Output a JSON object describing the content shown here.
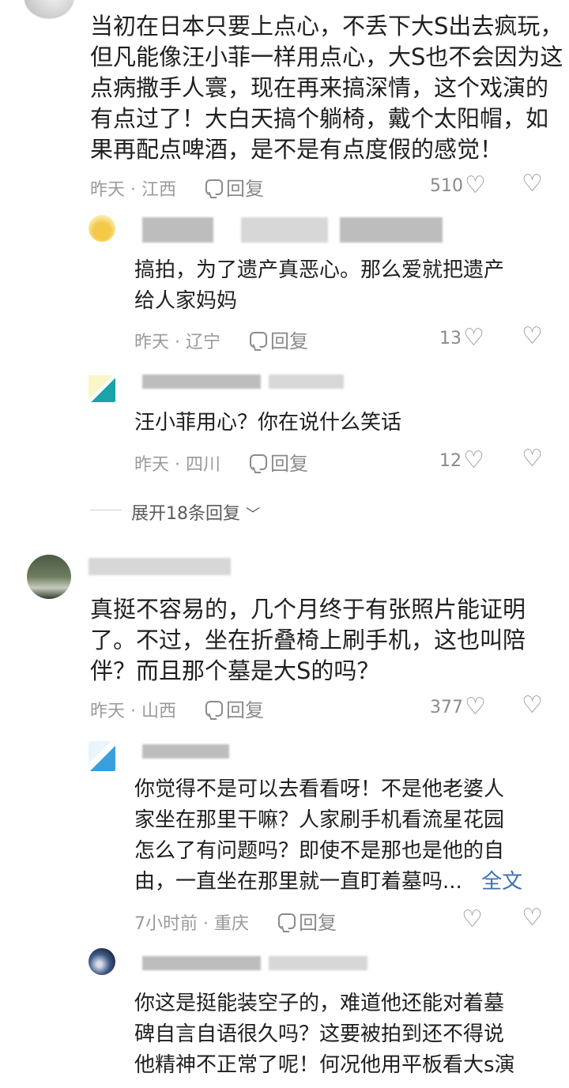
{
  "comments": [
    {
      "lines": [
        "当初在日本只要上点心，不丢下大S出去疯玩，",
        "但凡能像汪小菲一样用点心，大S也不会因为这",
        "点病撒手人寰，现在再来搞深情，这个戏演的",
        "有点过了！大白天搞个躺椅，戴个太阳帽，如",
        "果再配点啤酒，是不是有点度假的感觉！"
      ],
      "meta": "昨天 · 江西",
      "reply_label": "回复",
      "likes": "510",
      "replies": [
        {
          "lines": [
            "搞拍，为了遗产真恶心。那么爱就把遗产",
            "给人家妈妈"
          ],
          "meta": "昨天 · 辽宁",
          "reply_label": "回复",
          "likes": "13"
        },
        {
          "lines": [
            "汪小菲用心？你在说什么笑话"
          ],
          "meta": "昨天 · 四川",
          "reply_label": "回复",
          "likes": "12"
        }
      ],
      "expand_label": "展开18条回复"
    },
    {
      "lines": [
        "真挺不容易的，几个月终于有张照片能证明",
        "了。不过，坐在折叠椅上刷手机，这也叫陪",
        "伴？而且那个墓是大S的吗？"
      ],
      "meta": "昨天 · 山西",
      "reply_label": "回复",
      "likes": "377",
      "replies": [
        {
          "lines": [
            "你觉得不是可以去看看呀！不是他老婆人",
            "家坐在那里干嘛？人家刷手机看流星花园",
            "怎么了有问题吗？即使不是那也是他的自",
            "由，一直坐在那里就一直盯着墓吗..."
          ],
          "more_label": "全文",
          "meta": "7小时前 · 重庆",
          "reply_label": "回复",
          "likes": ""
        },
        {
          "lines": [
            "你这是挺能装空子的，难道他还能对着墓",
            "碑自言自语很久吗？这要被拍到还不得说",
            "他精神不正常了呢！何况他用平板看大s演"
          ]
        }
      ]
    }
  ],
  "icons": {
    "reply": "comment-bubble-icon",
    "like": "heart-outline-icon",
    "dislike": "broken-heart-icon",
    "expand": "chevron-down-icon"
  }
}
